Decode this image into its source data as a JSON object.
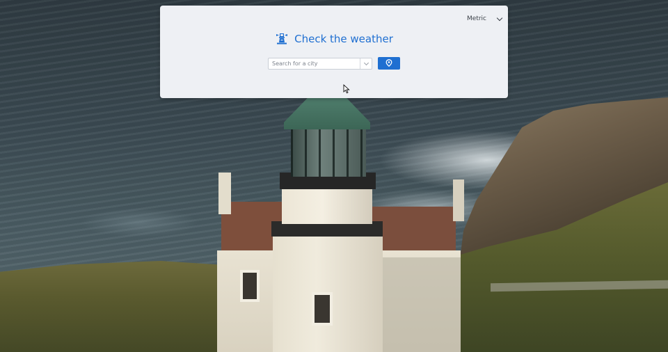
{
  "header": {
    "units_selected": "Metric",
    "title": "Check the weather"
  },
  "search": {
    "placeholder": "Search for a city",
    "value": ""
  },
  "icons": {
    "logo": "lighthouse-icon",
    "units_dropdown": "chevron-down-icon",
    "search_dropdown": "chevron-down-icon",
    "location_button": "map-pin-icon",
    "cursor": "mouse-pointer-icon"
  },
  "colors": {
    "accent": "#1f6fd1",
    "card_background": "#eef0f4"
  }
}
